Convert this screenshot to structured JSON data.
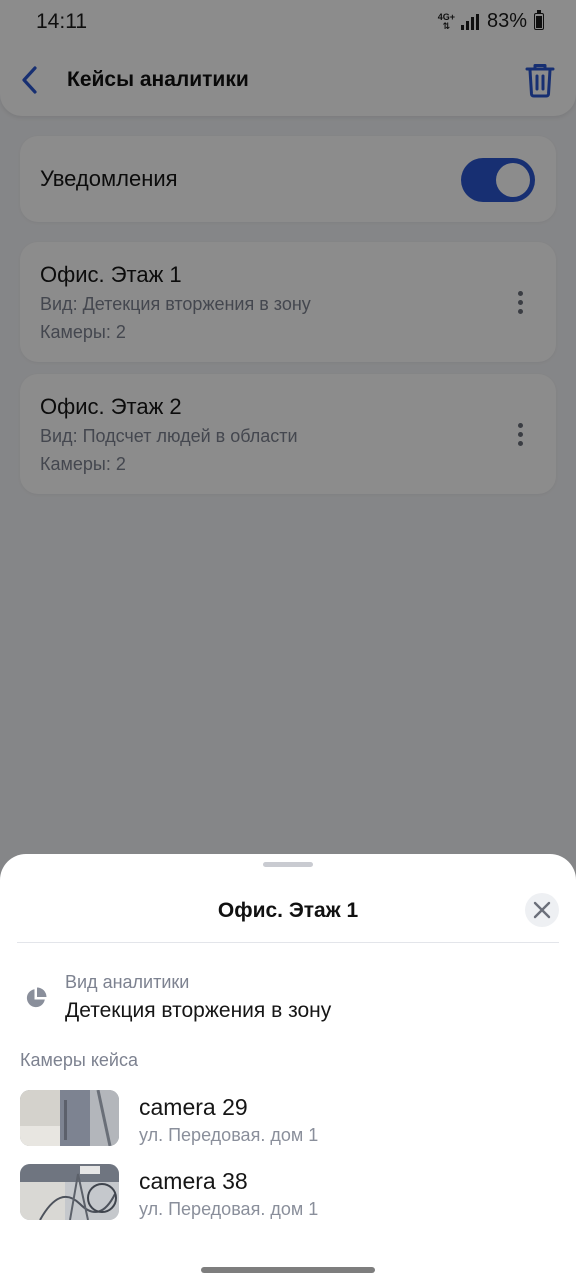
{
  "status_bar": {
    "time": "14:11",
    "network": "4G+",
    "battery": "83%"
  },
  "header": {
    "title": "Кейсы аналитики",
    "back_icon": "chevron-left-icon",
    "delete_icon": "trash-icon"
  },
  "notifications": {
    "label": "Уведомления",
    "enabled": true
  },
  "cases": [
    {
      "name": "Офис. Этаж 1",
      "type": "Вид: Детекция вторжения в зону",
      "cameras": "Камеры: 2"
    },
    {
      "name": "Офис. Этаж 2",
      "type": "Вид: Подсчет людей в области",
      "cameras": "Камеры: 2"
    }
  ],
  "sheet": {
    "title": "Офис. Этаж 1",
    "analytics_label": "Вид аналитики",
    "analytics_value": "Детекция вторжения в зону",
    "cameras_heading": "Камеры кейса",
    "cameras": [
      {
        "name": "camera 29",
        "address": "ул. Передовая. дом 1"
      },
      {
        "name": "camera 38",
        "address": "ул. Передовая. дом 1"
      }
    ]
  },
  "colors": {
    "accent": "#2a57cf",
    "scrim": "rgba(0,0,0,0.45)"
  }
}
